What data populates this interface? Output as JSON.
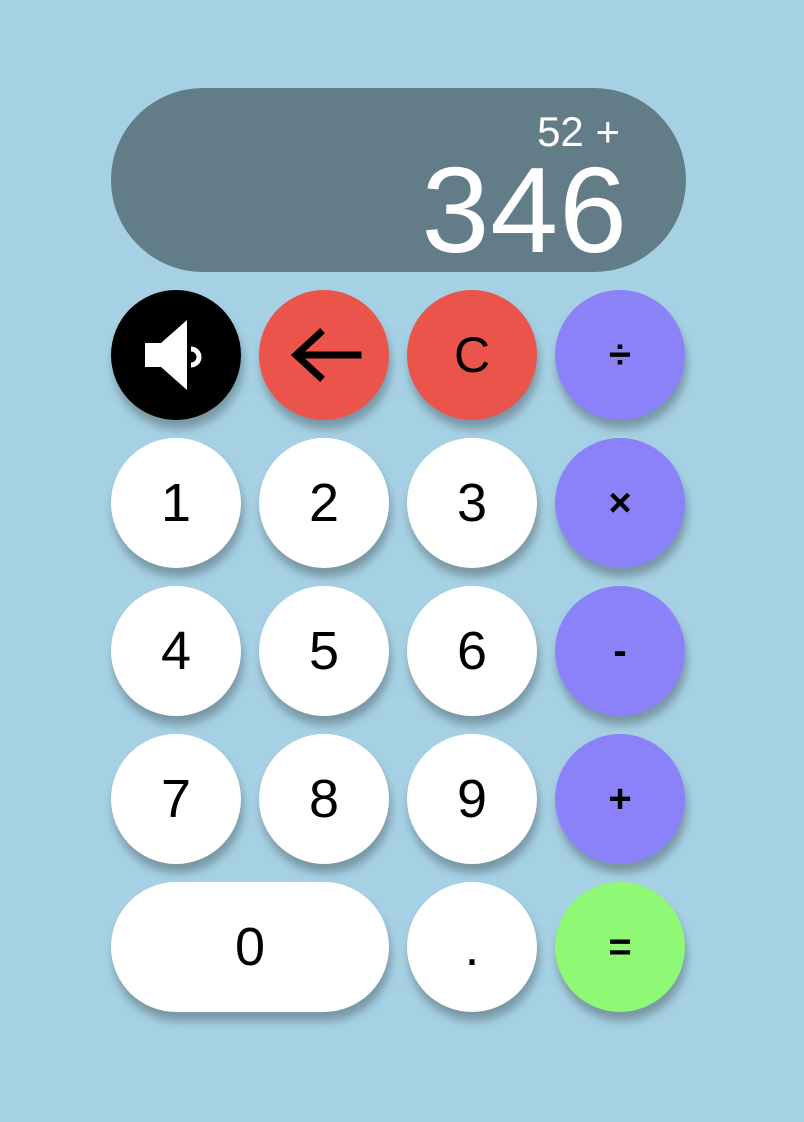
{
  "display": {
    "expression": "52 +",
    "value": "346"
  },
  "keys": {
    "sound_icon": "speaker-icon",
    "backspace_icon": "arrow-left-icon",
    "clear": "C",
    "divide": "÷",
    "multiply": "×",
    "subtract": "-",
    "add": "+",
    "equals": "=",
    "decimal": ".",
    "digits": {
      "zero": "0",
      "one": "1",
      "two": "2",
      "three": "3",
      "four": "4",
      "five": "5",
      "six": "6",
      "seven": "7",
      "eight": "8",
      "nine": "9"
    }
  },
  "colors": {
    "background": "#a6d1e4",
    "display": "#627d88",
    "digit_key": "#ffffff",
    "operator_key": "#8b82f9",
    "danger_key": "#ea544b",
    "equals_key": "#8ff975",
    "sound_key": "#000000"
  }
}
